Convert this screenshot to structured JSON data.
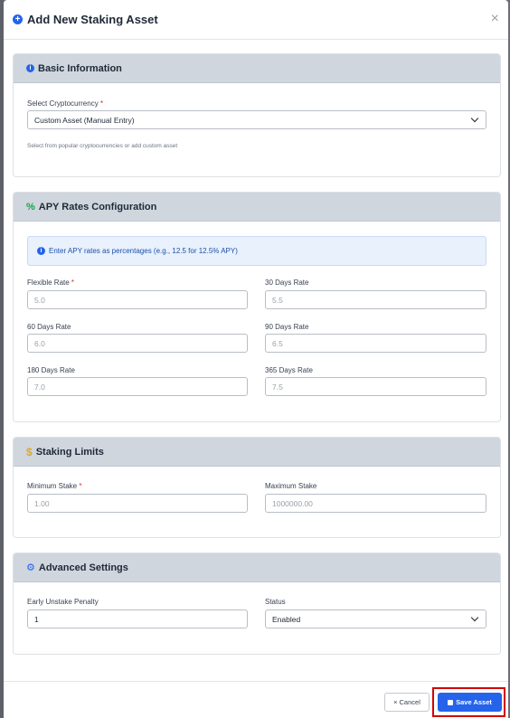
{
  "modal": {
    "title": "Add New Staking Asset",
    "close_glyph": "×",
    "icon": "plus-circle-icon"
  },
  "basic": {
    "title": "Basic Information",
    "crypto_label": "Select Cryptocurrency",
    "required_mark": "*",
    "crypto_value": "Custom Asset (Manual Entry)",
    "crypto_help": "Select from popular cryptocurrencies or add custom asset"
  },
  "apy": {
    "title": "APY Rates Configuration",
    "alert": "Enter APY rates as percentages (e.g., 12.5 for 12.5% APY)",
    "flexible_label": "Flexible Rate",
    "flexible_placeholder": "5.0",
    "d30_label": "30 Days Rate",
    "d30_placeholder": "5.5",
    "d60_label": "60 Days Rate",
    "d60_placeholder": "6.0",
    "d90_label": "90 Days Rate",
    "d90_placeholder": "6.5",
    "d180_label": "180 Days Rate",
    "d180_placeholder": "7.0",
    "d365_label": "365 Days Rate",
    "d365_placeholder": "7.5"
  },
  "limits": {
    "title": "Staking Limits",
    "min_label": "Minimum Stake",
    "min_placeholder": "1.00",
    "max_label": "Maximum Stake",
    "max_placeholder": "1000000.00"
  },
  "advanced": {
    "title": "Advanced Settings",
    "penalty_label": "Early Unstake Penalty",
    "penalty_value": "1",
    "status_label": "Status",
    "status_value": "Enabled"
  },
  "footer": {
    "cancel_label": "Cancel",
    "cancel_glyph": "×",
    "save_label": "Save Asset"
  },
  "colors": {
    "primary": "#2563eb",
    "header_bg": "#cfd6de",
    "required": "#dc2626",
    "highlight": "#d20000"
  }
}
